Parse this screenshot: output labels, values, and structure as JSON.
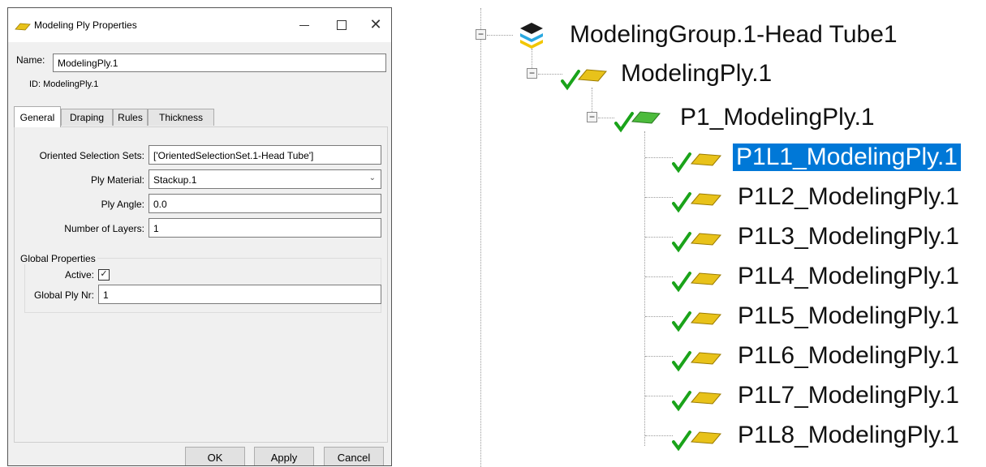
{
  "dialog": {
    "title": "Modeling Ply Properties",
    "name_label": "Name:",
    "name_value": "ModelingPly.1",
    "id_text": "ID: ModelingPly.1",
    "tabs": [
      "General",
      "Draping",
      "Rules",
      "Thickness"
    ],
    "active_tab": "General",
    "general": {
      "oss_label": "Oriented Selection Sets:",
      "oss_value": "['OrientedSelectionSet.1-Head Tube']",
      "material_label": "Ply Material:",
      "material_value": "Stackup.1",
      "angle_label": "Ply Angle:",
      "angle_value": "0.0",
      "layers_label": "Number of Layers:",
      "layers_value": "1",
      "global_title": "Global Properties",
      "active_label": "Active:",
      "active_checked": true,
      "global_nr_label": "Global Ply Nr:",
      "global_nr_value": "1"
    },
    "buttons": {
      "ok": "OK",
      "apply": "Apply",
      "cancel": "Cancel"
    },
    "icons": {
      "title": "ply-icon",
      "minimize": "minimize-icon",
      "maximize": "maximize-icon",
      "close": "close-icon"
    }
  },
  "tree": {
    "group": "ModelingGroup.1-Head Tube1",
    "modeling_ply": "ModelingPly.1",
    "production_ply": "P1_ModelingPly.1",
    "analysis_plies": [
      "P1L1_ModelingPly.1",
      "P1L2_ModelingPly.1",
      "P1L3_ModelingPly.1",
      "P1L4_ModelingPly.1",
      "P1L5_ModelingPly.1",
      "P1L6_ModelingPly.1",
      "P1L7_ModelingPly.1",
      "P1L8_ModelingPly.1"
    ],
    "selected_index": 0,
    "colors": {
      "selection": "#0078d7",
      "check": "#1aa31a",
      "ply_yellow": "#e8c21a",
      "ply_green": "#4cbb3c"
    }
  }
}
